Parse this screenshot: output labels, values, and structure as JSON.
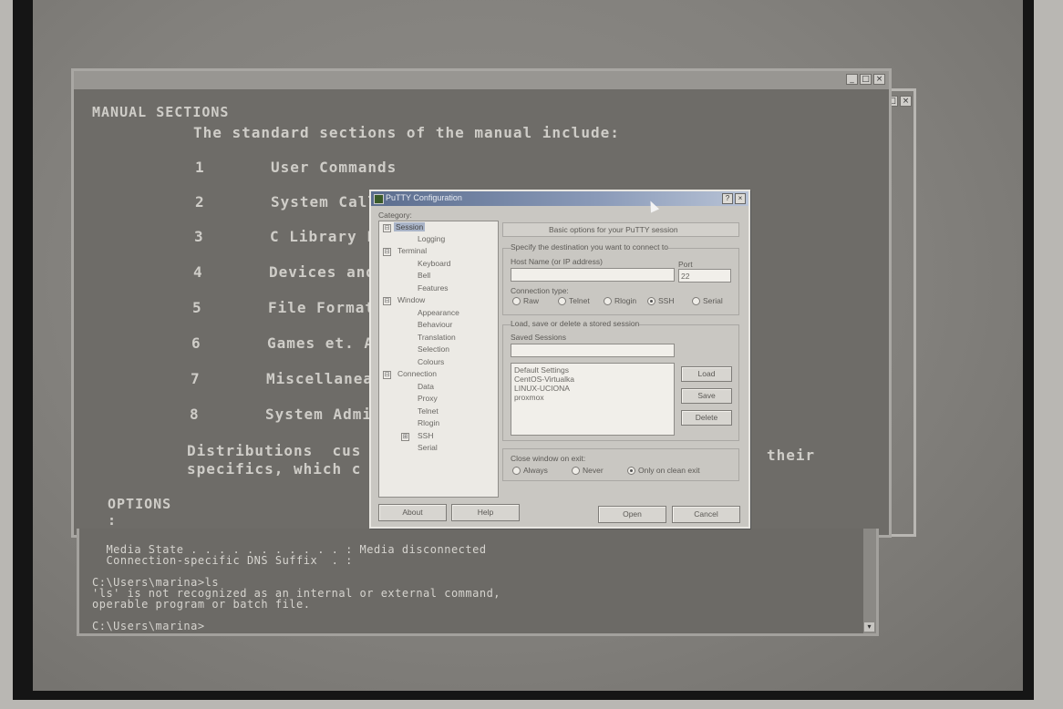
{
  "man_window": {
    "title": "",
    "heading": "MANUAL SECTIONS",
    "intro": "The standard sections of the manual include:",
    "sections": [
      {
        "num": "1",
        "name": "User Commands"
      },
      {
        "num": "2",
        "name": "System Call"
      },
      {
        "num": "3",
        "name": "C Library F"
      },
      {
        "num": "4",
        "name": "Devices and"
      },
      {
        "num": "5",
        "name": "File Format"
      },
      {
        "num": "6",
        "name": "Games et. A"
      },
      {
        "num": "7",
        "name": "Miscellanea"
      },
      {
        "num": "8",
        "name": "System Admi"
      }
    ],
    "dist_line1_a": "Distributions  cus",
    "dist_line1_b": "their",
    "dist_line2": "specifics, which c",
    "options": "OPTIONS",
    "prompt": ":"
  },
  "cmd_window": {
    "lines": [
      "  Media State . . . . . . . . . . . : Media disconnected",
      "  Connection-specific DNS Suffix  . :",
      "",
      "C:\\Users\\marina>ls",
      "'ls' is not recognized as an internal or external command,",
      "operable program or batch file.",
      "",
      "C:\\Users\\marina>"
    ]
  },
  "putty": {
    "title": "PuTTY Configuration",
    "category_label": "Category:",
    "tree": [
      {
        "label": "Session",
        "selected": true,
        "box": "⊟"
      },
      {
        "label": "Logging"
      },
      {
        "label": "Terminal",
        "box": "⊟"
      },
      {
        "label": "Keyboard"
      },
      {
        "label": "Bell"
      },
      {
        "label": "Features"
      },
      {
        "label": "Window",
        "box": "⊟"
      },
      {
        "label": "Appearance"
      },
      {
        "label": "Behaviour"
      },
      {
        "label": "Translation"
      },
      {
        "label": "Selection"
      },
      {
        "label": "Colours"
      },
      {
        "label": "Connection",
        "box": "⊟"
      },
      {
        "label": "Data"
      },
      {
        "label": "Proxy"
      },
      {
        "label": "Telnet"
      },
      {
        "label": "Rlogin"
      },
      {
        "label": "SSH",
        "box": "⊞"
      },
      {
        "label": "Serial"
      }
    ],
    "panel_header": "Basic options for your PuTTY session",
    "dest_group": "Specify the destination you want to connect to",
    "host_label": "Host Name (or IP address)",
    "host_value": "",
    "port_label": "Port",
    "port_value": "22",
    "conn_type_label": "Connection type:",
    "conn_types": [
      "Raw",
      "Telnet",
      "Rlogin",
      "SSH",
      "Serial"
    ],
    "conn_type_selected": "SSH",
    "sessions_group": "Load, save or delete a stored session",
    "saved_sessions_label": "Saved Sessions",
    "saved_sessions_value": "",
    "sessions": [
      "Default Settings",
      "CentOS-Virtualka",
      "LINUX-UCIONA",
      "proxmox"
    ],
    "load": "Load",
    "save": "Save",
    "delete": "Delete",
    "close_group": "Close window on exit:",
    "close_options": [
      "Always",
      "Never",
      "Only on clean exit"
    ],
    "close_selected": "Only on clean exit",
    "about": "About",
    "help": "Help",
    "open": "Open",
    "cancel": "Cancel"
  }
}
